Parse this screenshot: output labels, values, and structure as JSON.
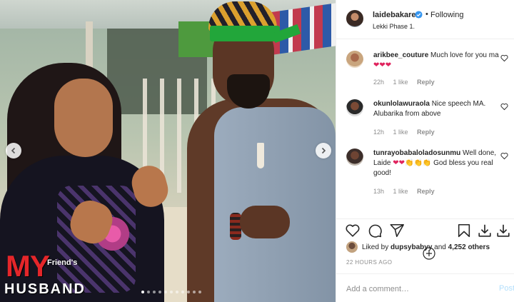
{
  "photo": {
    "logo": {
      "my": "MY",
      "friends": "Friend's",
      "husband": "HUSBAND"
    },
    "carousel": {
      "dot_count": 11,
      "active_index": 0
    }
  },
  "header": {
    "username": "laidebakare",
    "separator": "•",
    "follow_status": "Following",
    "location": "Lekki Phase 1."
  },
  "comments": [
    {
      "username": "arikbee_couture",
      "text": "Much love for you ma",
      "emojis": "❤❤❤",
      "age": "22h",
      "likes": "1 like",
      "reply": "Reply"
    },
    {
      "username": "okunlolawuraola",
      "text": "Nice speech MA. Alubarika from above",
      "age": "12h",
      "likes": "1 like",
      "reply": "Reply"
    },
    {
      "username": "tunrayobabaloladosunmu",
      "text_before": "Well done, Laide",
      "emojis_hearts": "❤❤",
      "emojis_claps": "👏👏👏",
      "text_after": "God bless you real good!",
      "age": "13h",
      "likes": "1 like",
      "reply": "Reply"
    }
  ],
  "likes": {
    "prefix": "Liked by",
    "user": "dupsybabyy",
    "middle": "and",
    "others": "4,252 others"
  },
  "time_ago": "22 HOURS AGO",
  "add_comment": {
    "placeholder": "Add a comment…",
    "post_label": "Post"
  },
  "colors": {
    "link_blue": "#0095f6",
    "post_disabled": "#b2dffc",
    "heart_red": "#e0245e",
    "muted": "#8e8e8e"
  },
  "icons": [
    "heart-icon",
    "comment-icon",
    "share-icon",
    "bookmark-icon",
    "download-icon",
    "download-icon-2",
    "verified-icon",
    "chevron-left-icon",
    "chevron-right-icon",
    "load-more-icon"
  ]
}
